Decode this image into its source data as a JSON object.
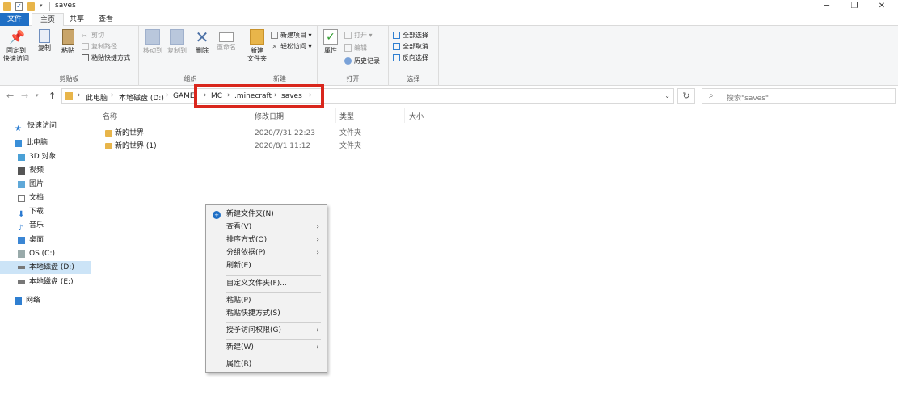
{
  "window": {
    "title": "saves",
    "minimize": "─",
    "maximize": "❐",
    "close": "✕"
  },
  "ribbon_tabs": [
    "文件",
    "主页",
    "共享",
    "查看"
  ],
  "ribbon": {
    "clipboard": {
      "pin_label": "固定到\n快速访问",
      "copy_label": "复制",
      "paste_label": "粘贴",
      "cut": "剪切",
      "copy_path": "复制路径",
      "paste_shortcut": "粘贴快捷方式",
      "group": "剪贴板"
    },
    "organize": {
      "move_to": "移动到",
      "copy_to": "复制到",
      "delete": "删除",
      "rename": "重命名",
      "group": "组织"
    },
    "new": {
      "new_folder": "新建\n文件夹",
      "new_item": "新建项目 ▾",
      "easy_access": "轻松访问 ▾",
      "group": "新建"
    },
    "open": {
      "properties": "属性",
      "open": "打开 ▾",
      "edit": "编辑",
      "history": "历史记录",
      "group": "打开"
    },
    "select": {
      "select_all": "全部选择",
      "select_none": "全部取消",
      "invert": "反向选择",
      "group": "选择"
    }
  },
  "address": {
    "crumbs": [
      "此电脑",
      "本地磁盘 (D:)",
      "GAME",
      "MC",
      ".minecraft",
      "saves"
    ],
    "search_placeholder": "搜索\"saves\""
  },
  "sidebar": {
    "items": [
      {
        "label": "快速访问",
        "icon": "star-icon"
      },
      {
        "label": "此电脑",
        "icon": "computer-icon"
      },
      {
        "label": "3D 对象",
        "icon": "3d-objects-icon"
      },
      {
        "label": "视频",
        "icon": "video-icon"
      },
      {
        "label": "图片",
        "icon": "pictures-icon"
      },
      {
        "label": "文档",
        "icon": "documents-icon"
      },
      {
        "label": "下载",
        "icon": "download-icon"
      },
      {
        "label": "音乐",
        "icon": "music-icon"
      },
      {
        "label": "桌面",
        "icon": "desktop-icon"
      },
      {
        "label": "OS (C:)",
        "icon": "drive-icon"
      },
      {
        "label": "本地磁盘 (D:)",
        "icon": "drive-icon"
      },
      {
        "label": "本地磁盘 (E:)",
        "icon": "drive-icon"
      },
      {
        "label": "网络",
        "icon": "network-icon"
      }
    ]
  },
  "file_list": {
    "columns": [
      "名称",
      "修改日期",
      "类型",
      "大小"
    ],
    "rows": [
      {
        "name": "新的世界",
        "modified": "2020/7/31 22:23",
        "type": "文件夹"
      },
      {
        "name": "新的世界 (1)",
        "modified": "2020/8/1 11:12",
        "type": "文件夹"
      }
    ]
  },
  "context_menu": {
    "items": [
      {
        "label": "新建文件夹(N)",
        "submenu": false
      },
      {
        "label": "查看(V)",
        "submenu": true
      },
      {
        "label": "排序方式(O)",
        "submenu": true
      },
      {
        "label": "分组依据(P)",
        "submenu": true
      },
      {
        "label": "刷新(E)",
        "submenu": false
      },
      {
        "label": "自定义文件夹(F)...",
        "submenu": false
      },
      {
        "label": "粘贴(P)",
        "submenu": false
      },
      {
        "label": "粘贴快捷方式(S)",
        "submenu": false
      },
      {
        "label": "授予访问权限(G)",
        "submenu": true
      },
      {
        "label": "新建(W)",
        "submenu": true
      },
      {
        "label": "属性(R)",
        "submenu": false
      }
    ]
  },
  "colors": {
    "accent": "#1f6fc5",
    "highlight_box": "#d9261c",
    "folder": "#e8b54a",
    "selection": "#cce4f7"
  }
}
